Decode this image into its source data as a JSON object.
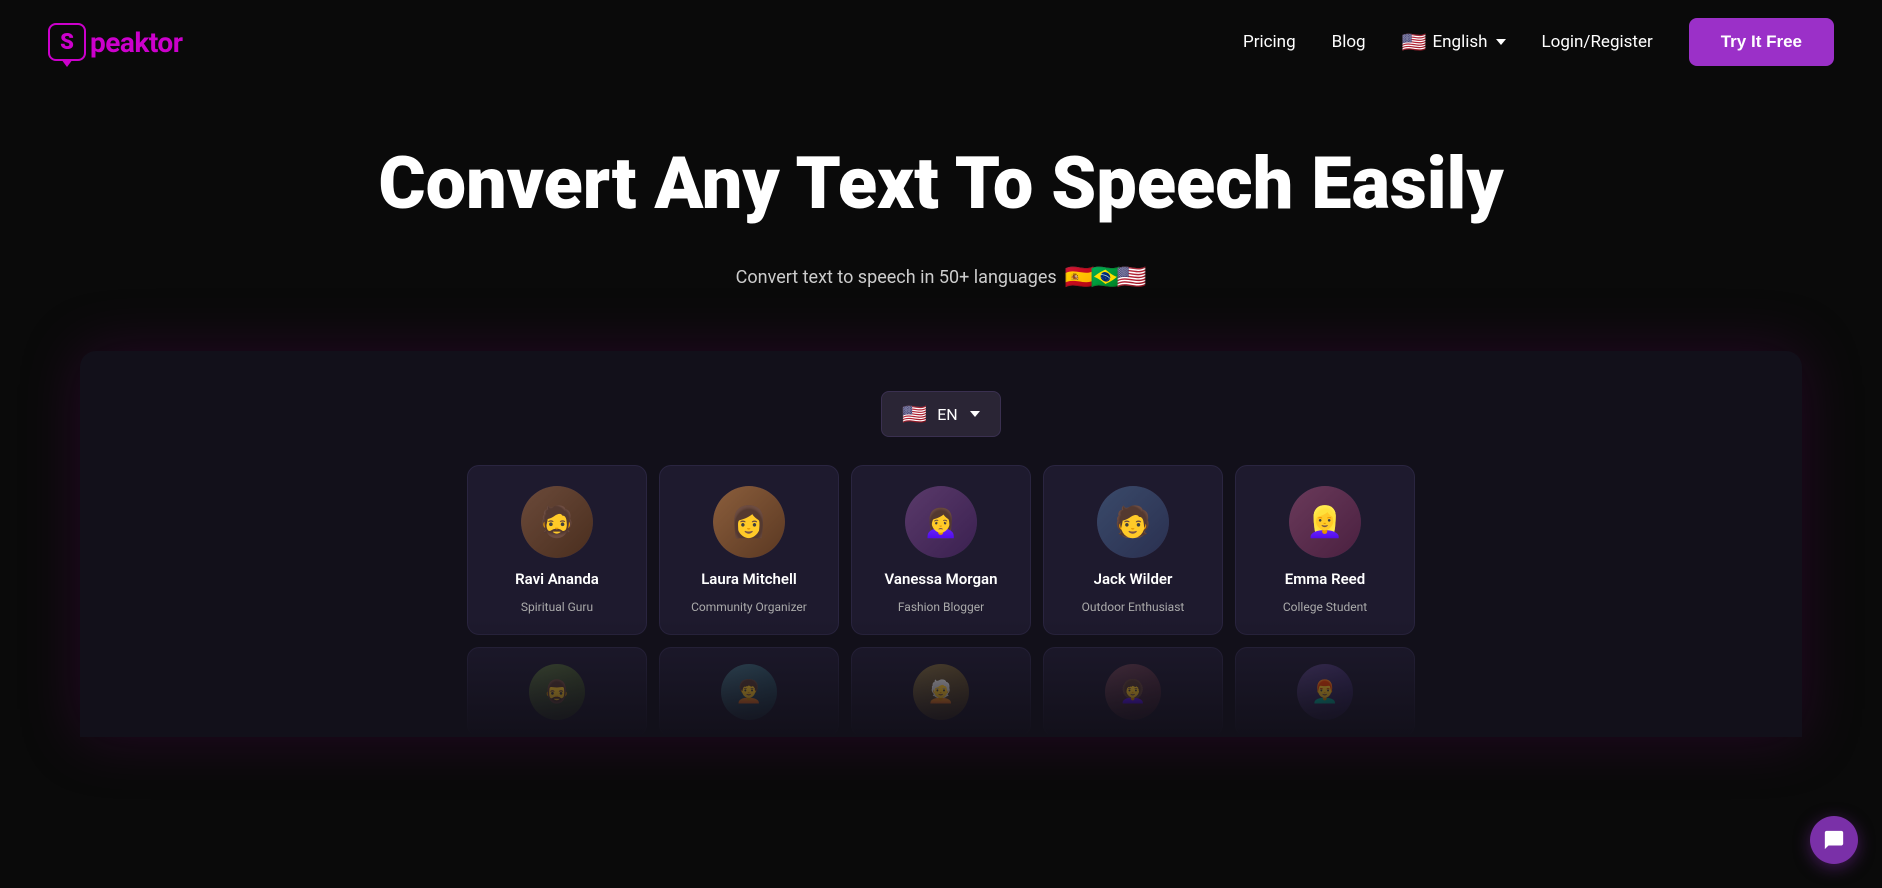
{
  "nav": {
    "logo_letter": "S",
    "logo_name": "peaktor",
    "pricing_label": "Pricing",
    "blog_label": "Blog",
    "language_label": "English",
    "login_label": "Login/Register",
    "try_free_label": "Try It Free"
  },
  "hero": {
    "title": "Convert Any Text To Speech Easily",
    "subtitle": "Convert text to speech in 50+ languages",
    "flags": [
      "🇪🇸",
      "🇧🇷",
      "🇺🇸"
    ]
  },
  "app_panel": {
    "lang_selector": "EN",
    "voices": [
      {
        "name": "Ravi Ananda",
        "role": "Spiritual Guru",
        "emoji": "🧔"
      },
      {
        "name": "Laura Mitchell",
        "role": "Community Organizer",
        "emoji": "👩"
      },
      {
        "name": "Vanessa Morgan",
        "role": "Fashion Blogger",
        "emoji": "🙍‍♀️"
      },
      {
        "name": "Jack Wilder",
        "role": "Outdoor Enthusiast",
        "emoji": "🧑"
      },
      {
        "name": "Emma Reed",
        "role": "College Student",
        "emoji": "👱‍♀️"
      }
    ],
    "voices_row2": [
      {
        "name": "",
        "role": "",
        "emoji": "🧔‍♂️"
      },
      {
        "name": "",
        "role": "",
        "emoji": "🧑‍🦱"
      },
      {
        "name": "",
        "role": "",
        "emoji": "🧑‍🦳"
      },
      {
        "name": "",
        "role": "",
        "emoji": "👩‍🦱"
      },
      {
        "name": "",
        "role": "",
        "emoji": "👨‍🦰"
      }
    ]
  }
}
